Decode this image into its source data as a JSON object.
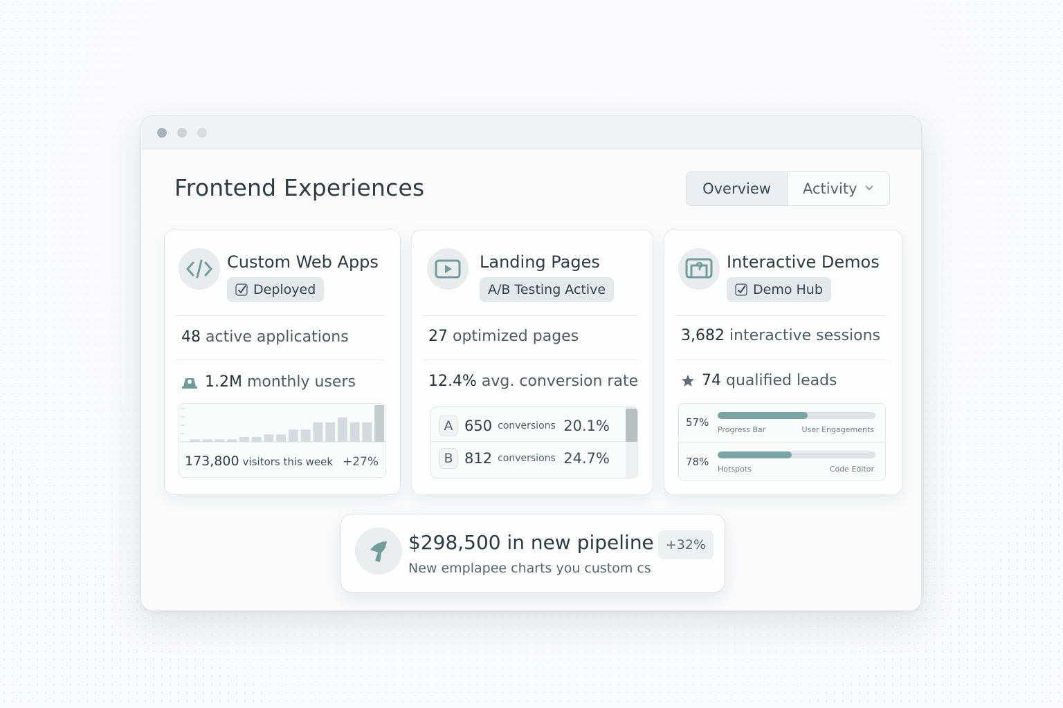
{
  "header": {
    "title": "Frontend Experiences",
    "tabs": [
      {
        "label": "Overview"
      },
      {
        "label": "Activity"
      }
    ]
  },
  "cards": [
    {
      "title": "Custom Web Apps",
      "badge": "Deployed",
      "stat1_num": "48",
      "stat1_label": "active applications",
      "stat2_num": "1.2M",
      "stat2_label": "monthly users",
      "chart": {
        "visitors": "173,800",
        "visitors_label": "visitors this week",
        "change": "+27%"
      }
    },
    {
      "title": "Landing Pages",
      "badge": "A/B Testing Active",
      "stat1_num": "27",
      "stat1_label": "optimized pages",
      "stat2_num": "12.4%",
      "stat2_label": "avg. conversion rate",
      "ab": [
        {
          "variant": "A",
          "conversions": "650",
          "label": "conversions",
          "rate": "20.1%"
        },
        {
          "variant": "B",
          "conversions": "812",
          "label": "conversions",
          "rate": "24.7%"
        }
      ]
    },
    {
      "title": "Interactive Demos",
      "badge": "Demo Hub",
      "stat1_num": "3,682",
      "stat1_label": "interactive sessions",
      "stat2_num": "74",
      "stat2_label": "qualified leads",
      "progress": [
        {
          "pct": "57%",
          "value": 0.57,
          "left": "Progress Bar",
          "right": "User Engagements"
        },
        {
          "pct": "78%",
          "value": 0.47,
          "left": "Hotspots",
          "right": "Code Editor"
        }
      ]
    }
  ],
  "pipeline": {
    "title": "$298,500 in new pipeline",
    "subtitle": "New emplapee charts you custom cs",
    "change": "+32%"
  },
  "chart_data": {
    "type": "bar",
    "values": [
      1,
      1,
      1,
      1,
      2,
      2,
      3,
      3,
      5,
      5,
      8,
      8,
      10,
      8,
      8,
      15
    ],
    "ylim": [
      0,
      15
    ]
  },
  "colors": {
    "accent": "#79a5a2",
    "icon": "#6f9c99",
    "text": "#2f3b42"
  },
  "icons": {
    "card1": "code-icon",
    "card2": "play-icon",
    "card3": "demo-icon",
    "users": "users-icon",
    "leads": "star-icon",
    "pipeline": "arrow-up-icon"
  }
}
